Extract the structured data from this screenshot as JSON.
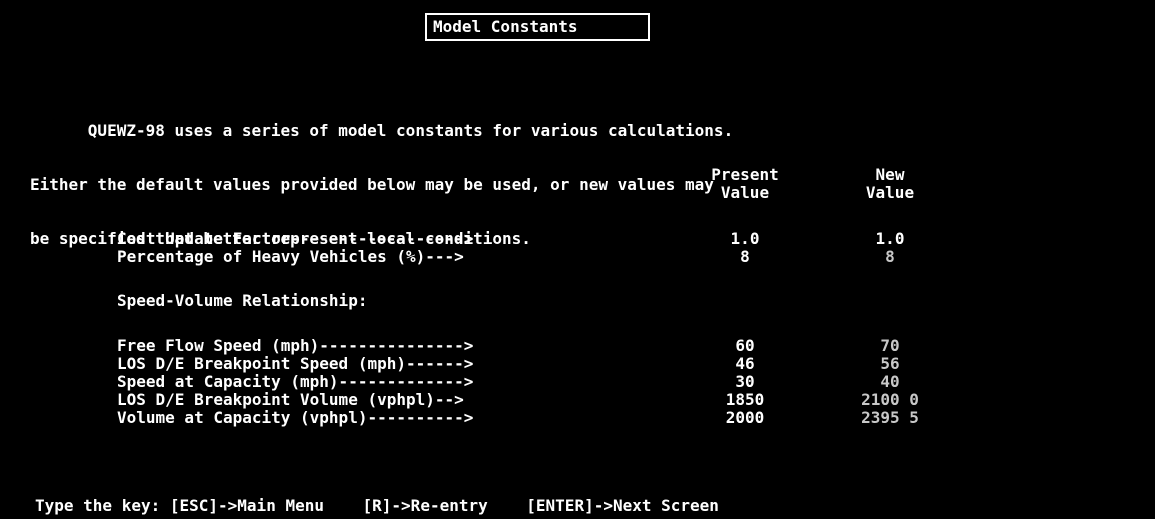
{
  "title": "Model Constants",
  "intro": [
    "      QUEWZ-98 uses a series of model constants for various calculations.",
    "Either the default values provided below may be used, or new values may",
    "be specified that better represent local conditions."
  ],
  "headers": {
    "present_line1": "Present",
    "present_line2": "Value",
    "new_line1": "New",
    "new_line2": "Value"
  },
  "section_label": "Speed-Volume Relationship:",
  "rows": [
    {
      "label": "Cost Update Factor------------------>",
      "present": "1.0",
      "new": "1.0",
      "suffix": ""
    },
    {
      "label": "Percentage of Heavy Vehicles (%)--->",
      "present": "8",
      "new": "8",
      "suffix": ""
    },
    {
      "label": "Free Flow Speed (mph)--------------->",
      "present": "60",
      "new": "70",
      "suffix": ""
    },
    {
      "label": "LOS D/E Breakpoint Speed (mph)------>",
      "present": "46",
      "new": "56",
      "suffix": ""
    },
    {
      "label": "Speed at Capacity (mph)------------->",
      "present": "30",
      "new": "40",
      "suffix": ""
    },
    {
      "label": "LOS D/E Breakpoint Volume (vphpl)-->",
      "present": "1850",
      "new": "2100",
      "suffix": " 0"
    },
    {
      "label": "Volume at Capacity (vphpl)---------->",
      "present": "2000",
      "new": "2395",
      "suffix": " 5"
    }
  ],
  "footer": "Type the key: [ESC]->Main Menu    [R]->Re-entry    [ENTER]->Next Screen",
  "colors": {
    "background": "#000000",
    "text": "#ffffff",
    "new_value_text": "#c8c8c8"
  }
}
